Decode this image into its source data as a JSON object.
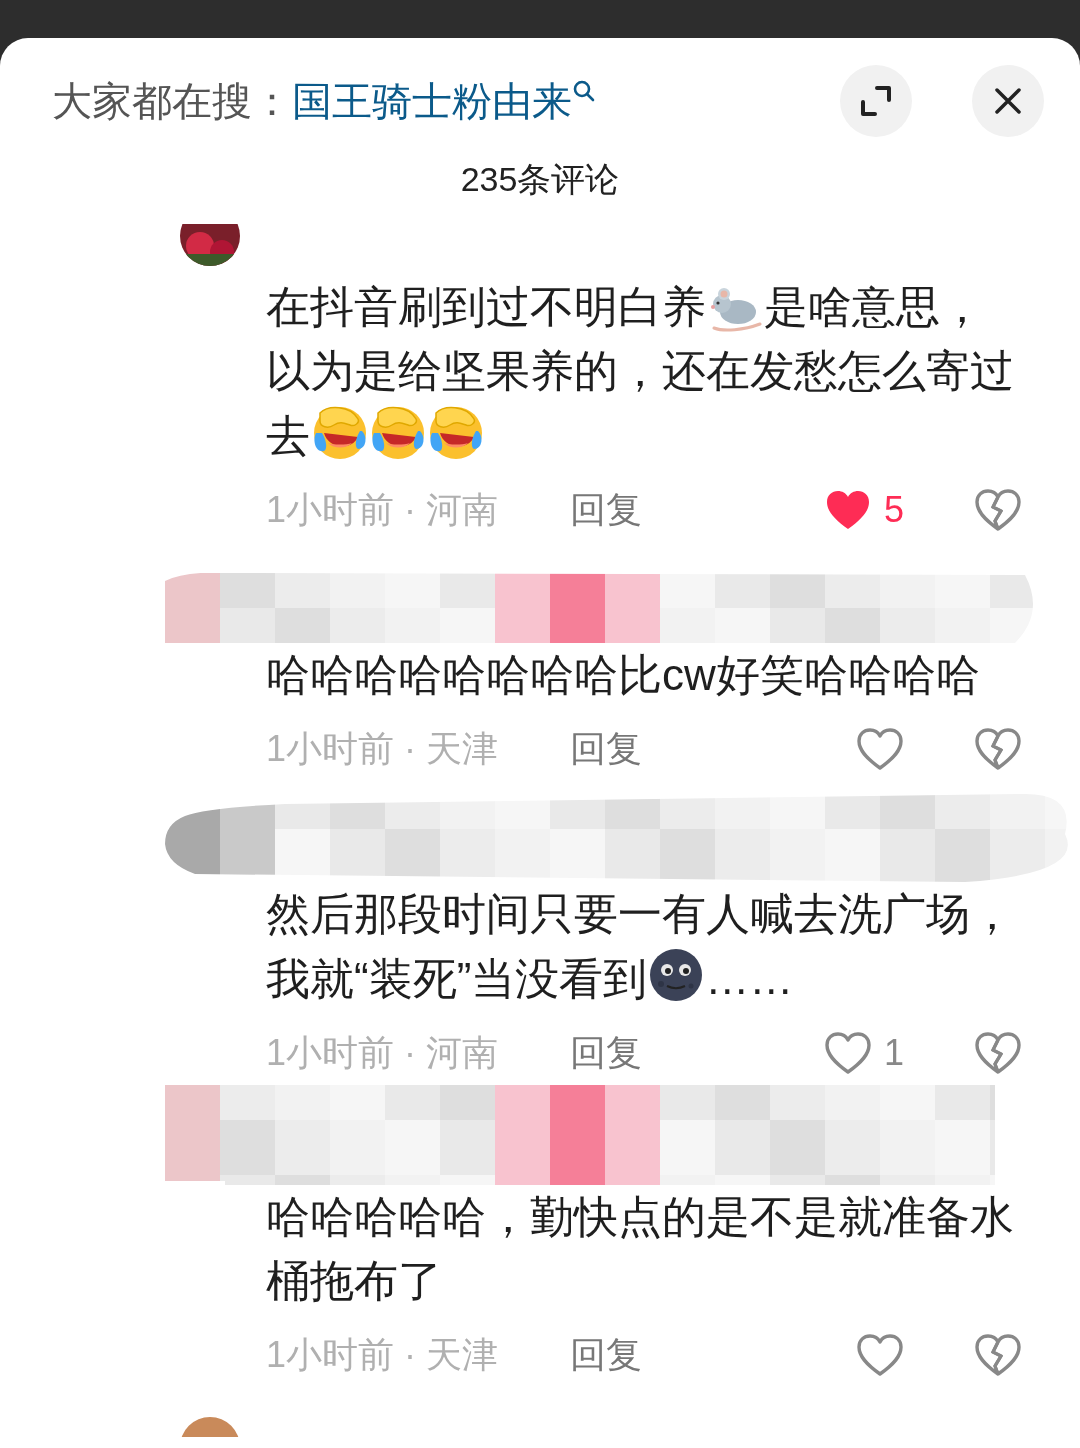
{
  "header": {
    "search_label": "大家都在搜：",
    "search_link": "国王骑士粉由来"
  },
  "title": "235条评论",
  "items": [
    {
      "kind": "avatar"
    },
    {
      "kind": "comment",
      "lines": [
        [
          {
            "kind": "text",
            "text": "在抖音刷到过不明白养"
          },
          {
            "kind": "mouse"
          },
          {
            "kind": "text",
            "text": "是啥意思，"
          }
        ],
        [
          {
            "kind": "text",
            "text": "以为是给坚果养的，还在发愁怎么寄过"
          }
        ],
        [
          {
            "kind": "text",
            "text": "去"
          },
          {
            "kind": "laugh"
          },
          {
            "kind": "laugh"
          },
          {
            "kind": "laugh"
          }
        ]
      ],
      "meta": "1小时前 · 河南",
      "reply": "回复",
      "liked": true,
      "likes": "5"
    },
    {
      "kind": "redaction"
    },
    {
      "kind": "comment",
      "lines": [
        [
          {
            "kind": "text",
            "text": "哈哈哈哈哈哈哈哈比cw好笑哈哈哈哈"
          }
        ]
      ],
      "meta": "1小时前 · 天津",
      "reply": "回复",
      "liked": false
    },
    {
      "kind": "redaction"
    },
    {
      "kind": "comment",
      "lines": [
        [
          {
            "kind": "text",
            "text": "然后那段时间只要一有人喊去洗广场，"
          }
        ],
        [
          {
            "kind": "text",
            "text": "我就“装死”当没看到"
          },
          {
            "kind": "moon"
          },
          {
            "kind": "text",
            "text": "……"
          }
        ]
      ],
      "meta": "1小时前 · 河南",
      "reply": "回复",
      "liked": false,
      "likes": "1"
    },
    {
      "kind": "redaction"
    },
    {
      "kind": "comment",
      "lines": [
        [
          {
            "kind": "text",
            "text": "哈哈哈哈哈，勤快点的是不是就准备水"
          }
        ],
        [
          {
            "kind": "text",
            "text": "桶拖布了"
          }
        ]
      ],
      "meta": "1小时前 · 天津",
      "reply": "回复",
      "liked": false
    },
    {
      "kind": "avatar"
    }
  ]
}
